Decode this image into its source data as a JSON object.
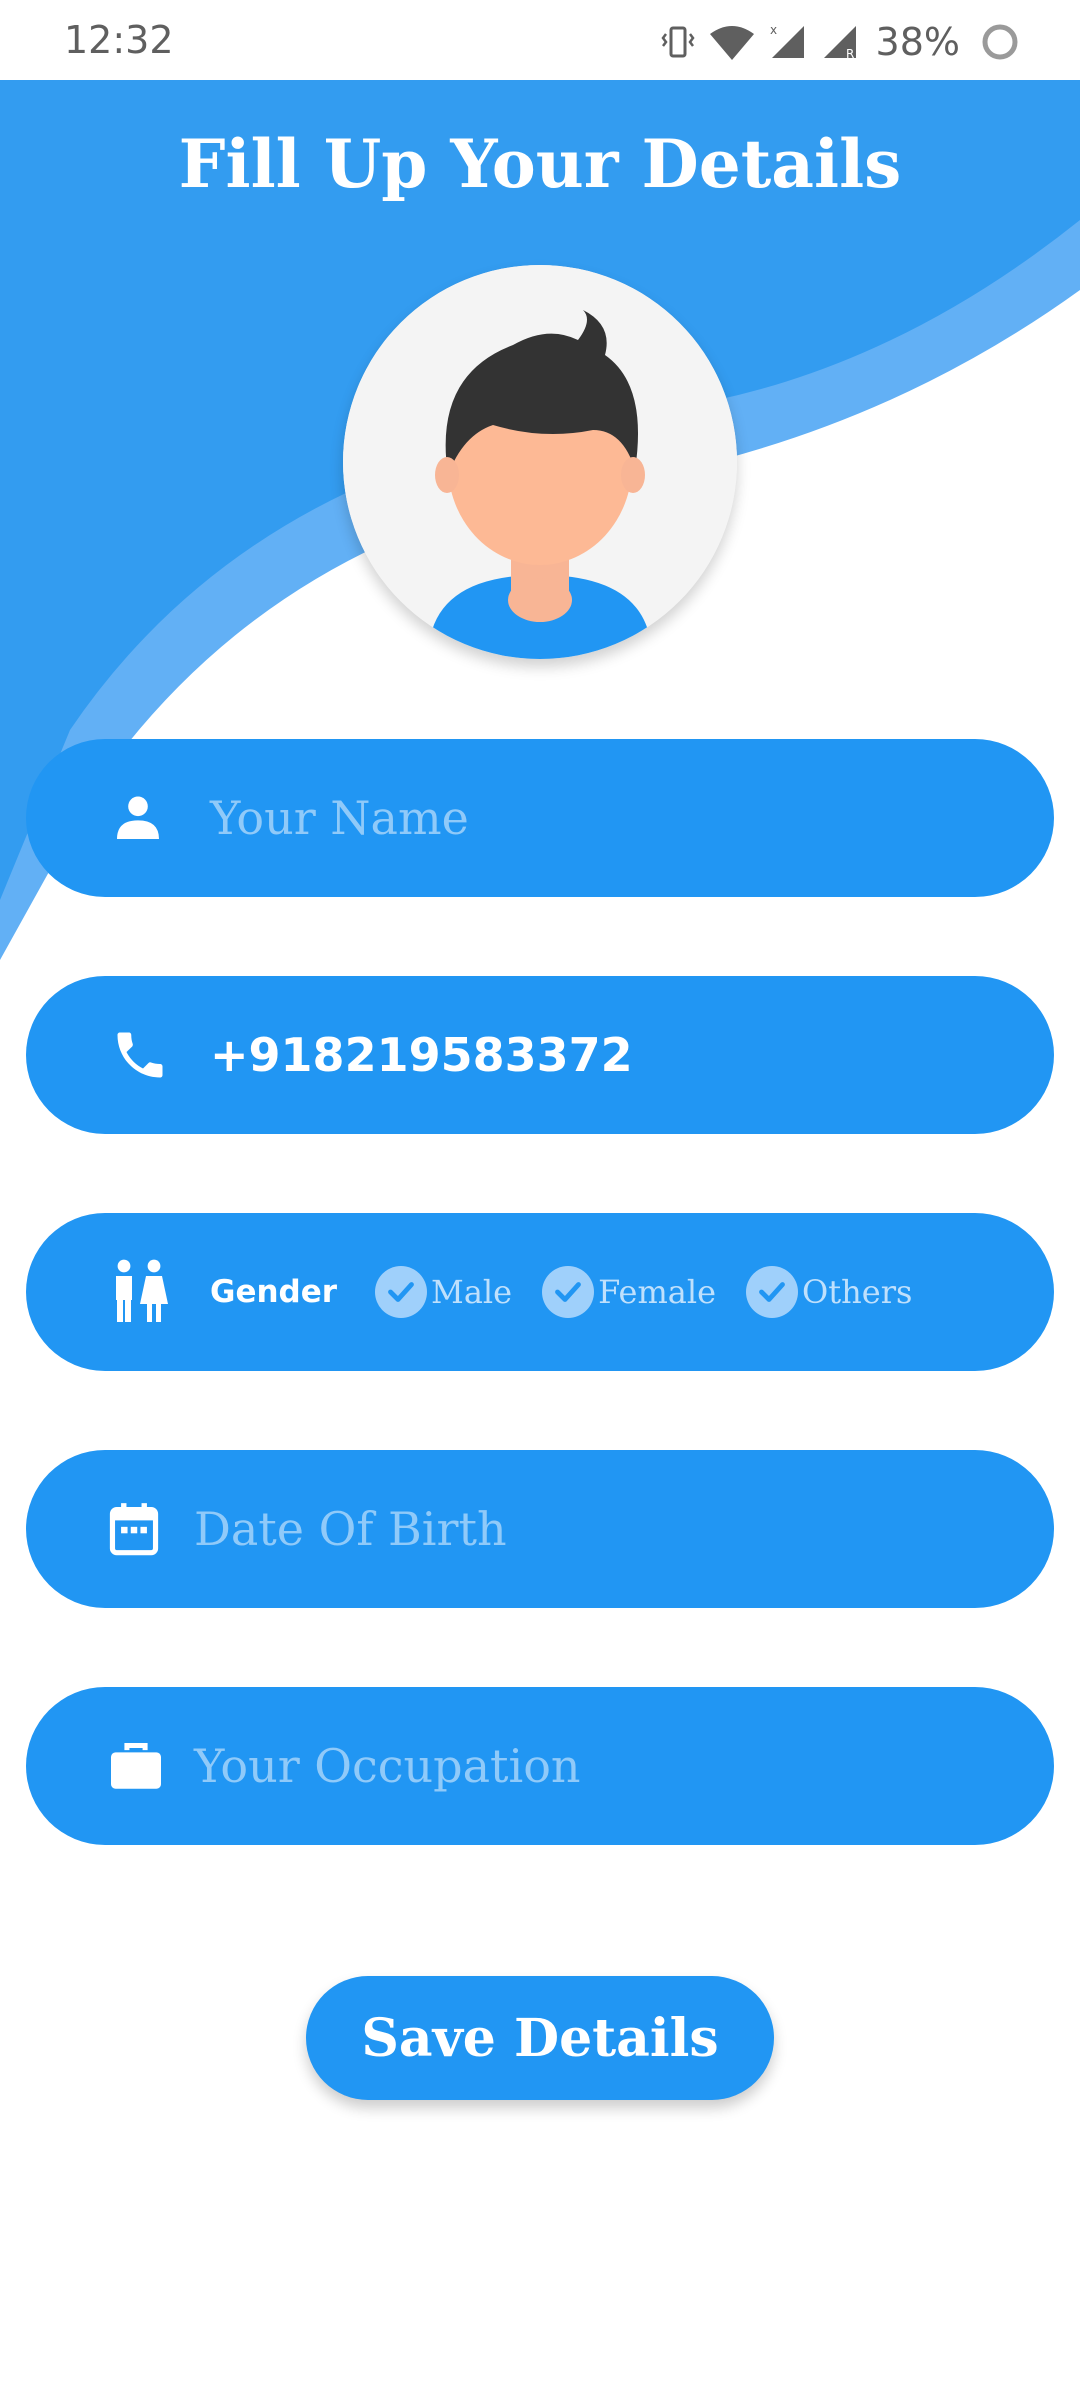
{
  "status_bar": {
    "time": "12:32",
    "battery": "38%",
    "icons": [
      "vibrate-icon",
      "wifi-icon",
      "signal-icon",
      "signal-roaming-icon",
      "battery-icon"
    ]
  },
  "page": {
    "title": "Fill Up Your Details"
  },
  "form": {
    "name": {
      "placeholder": "Your Name",
      "icon": "person-icon"
    },
    "phone": {
      "value": "+918219583372",
      "icon": "phone-icon"
    },
    "gender": {
      "label": "Gender",
      "icon": "gender-icon",
      "options": [
        "Male",
        "Female",
        "Others"
      ]
    },
    "dob": {
      "placeholder": "Date Of Birth",
      "icon": "calendar-icon"
    },
    "occupation": {
      "placeholder": "Your Occupation",
      "icon": "briefcase-icon"
    }
  },
  "actions": {
    "save_label": "Save Details"
  },
  "colors": {
    "primary": "#2196f3",
    "header_light": "#62b0f5",
    "placeholder": "#90caf9"
  }
}
